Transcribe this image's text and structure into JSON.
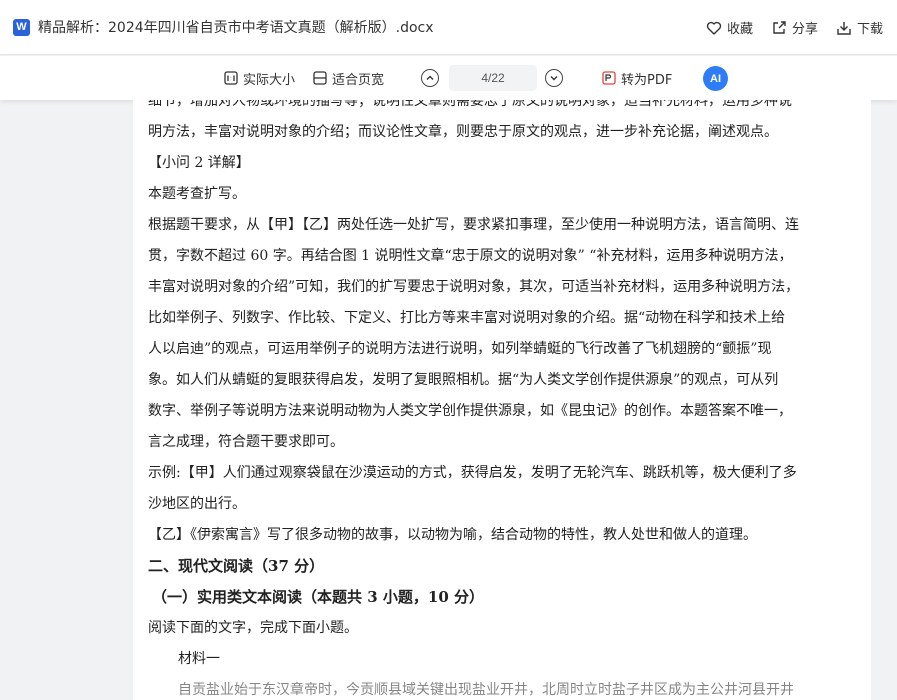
{
  "titlebar": {
    "logo": "W",
    "title": "精品解析：2024年四川省自贡市中考语文真题（解析版）.docx",
    "favorite_label": "收藏",
    "share_label": "分享",
    "download_label": "下载"
  },
  "toolbar": {
    "actual_size_label": "实际大小",
    "fit_width_label": "适合页宽",
    "page_indicator": "4/22",
    "to_pdf_label": "转为PDF",
    "ai_label": "AI"
  },
  "document": {
    "lines": [
      "细节，增加对人物或环境的描写等；说明性文章则需要忠于原文的说明对象，适当补充材料，运用多种说",
      "明方法，丰富对说明对象的介绍；而议论性文章，则要忠于原文的观点，进一步补充论据，阐述观点。",
      "【小问 2 详解】",
      "本题考查扩写。",
      "根据题干要求，从【甲】【乙】两处任选一处扩写，要求紧扣事理，至少使用一种说明方法，语言简明、连",
      "贯，字数不超过 60 字。再结合图 1 说明性文章“忠于原文的说明对象” “补充材料，运用多种说明方法，",
      "丰富对说明对象的介绍”可知，我们的扩写要忠于说明对象，其次，可适当补充材料，运用多种说明方法，",
      "比如举例子、列数字、作比较、下定义、打比方等来丰富对说明对象的介绍。据“动物在科学和技术上给",
      "人以启迪”的观点，可运用举例子的说明方法进行说明，如列举蜻蜓的飞行改善了飞机翅膀的“颤振”现",
      "象。如人们从蜻蜓的复眼获得启发，发明了复眼照相机。据“为人类文学创作提供源泉”的观点，可从列",
      "数字、举例子等说明方法来说明动物为人类文学创作提供源泉，如《昆虫记》的创作。本题答案不唯一，",
      "言之成理，符合题干要求即可。",
      "示例:【甲】人们通过观察袋鼠在沙漠运动的方式，获得启发，发明了无轮汽车、跳跃机等，极大便利了多",
      "沙地区的出行。",
      "【乙】《伊索寓言》写了很多动物的故事，以动物为喻，结合动物的特性，教人处世和做人的道理。"
    ],
    "section_heading": "二、现代文阅读（37 分）",
    "subsection_heading": "（一）实用类文本阅读（本题共 3 小题，10 分）",
    "instruction": "阅读下面的文字，完成下面小题。",
    "material_label": "材料一",
    "cut_line": "自贡盐业始于东汉章帝时，今贡顺县域关键出现盐业开井，北周时立时盐子井区成为主公井河县开井"
  }
}
